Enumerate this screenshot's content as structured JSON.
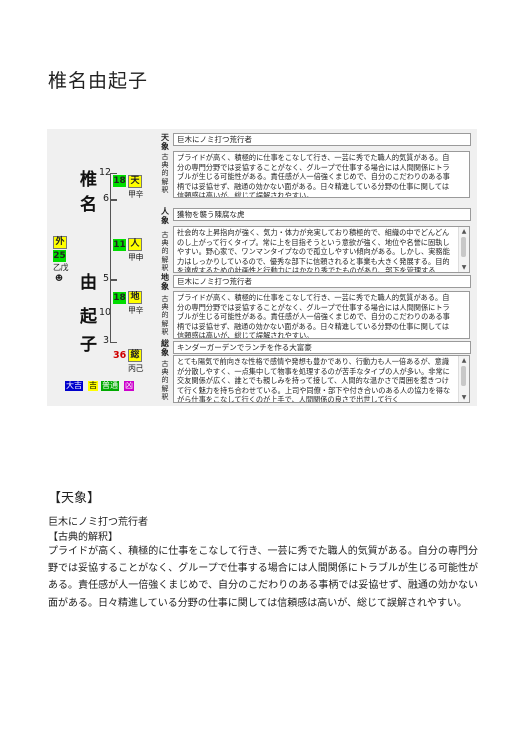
{
  "title": "椎名由起子",
  "name_chars": [
    {
      "char": "椎",
      "strokes": "12"
    },
    {
      "char": "名",
      "strokes": "6"
    },
    {
      "char": "由",
      "strokes": "5"
    },
    {
      "char": "起",
      "strokes": "10"
    },
    {
      "char": "子",
      "strokes": "3"
    }
  ],
  "kaku": {
    "ten": {
      "value": "18",
      "label": "天",
      "sub": "甲辛"
    },
    "jin": {
      "value": "11",
      "label": "人",
      "sub": "甲申"
    },
    "chi": {
      "value": "18",
      "label": "地",
      "sub": "甲辛"
    },
    "gai": {
      "value": "25",
      "label": "外",
      "sub": "乙戊"
    },
    "so": {
      "value": "36",
      "label": "総",
      "sub": "丙己"
    }
  },
  "luck_labels": [
    "大吉",
    "吉",
    "普通",
    "凶"
  ],
  "sections": [
    {
      "label": "天象",
      "sub": "古典的解釈",
      "title": "巨木にノミ打つ荒行者",
      "memo": "プライドが高く、積極的に仕事をこなして行き、一芸に秀でた職人的気質がある。自分の専門分野では妥協することがなく、グループで仕事する場合には人間関係にトラブルが生じる可能性がある。責任感が人一倍強くまじめで、自分のこだわりのある事柄では妥協せず、融通の効かない面がある。日々精進している分野の仕事に関しては信頼感は高いが、総じて誤解されやすい。"
    },
    {
      "label": "人象",
      "sub": "古典的解釈",
      "title": "獲物を襲う陳腐な虎",
      "memo": "社会的な上昇指向が強く、気力・体力が充実しており積極的で、組織の中でどんどんのし上がって行くタイプ。常に上を目指そうという意欲が強く、地位や名誉に固執しやすい。野心家で、ワンマンタイプなので孤立しやすい傾向がある。しかし、実務能力はしっかりしているので、優秀な部下に信頼されると事業も大きく発展する。目的を達成するための計画性と行動力にはかなり秀でたものがあり、部下を管理する"
    },
    {
      "label": "地象",
      "sub": "古典的解釈",
      "title": "巨木にノミ打つ荒行者",
      "memo": "プライドが高く、積極的に仕事をこなして行き、一芸に秀でた職人的気質がある。自分の専門分野では妥協することがなく、グループで仕事する場合には人間関係にトラブルが生じる可能性がある。責任感が人一倍強くまじめで、自分のこだわりのある事柄では妥協せず、融通の効かない面がある。日々精進している分野の仕事に関しては信頼感は高いが、総じて誤解されやすい。"
    },
    {
      "label": "総象",
      "sub": "古典的解釈",
      "title": "キンダーガーデンでランチを作る大富豪",
      "memo": "とても陽気で前向きな性格で感情や発想も豊かであり、行動力も人一倍あるが、意識が分散しやすく、一点集中して物事を処理するのが苦手なタイプの人が多い。非常に交友関係が広く、誰とでも親しみを持って接して、人間的な温かさで周囲を惹きつけて行く魅力を持ち合わせている。上司や同僚・部下や付き合いのある人の協力を得ながら仕事をこなして行くのが上手で、人間関係の良さで出世して行く"
    }
  ],
  "lower": {
    "heading": "【天象】",
    "lead": "巨木にノミ打つ荒行者",
    "sub": "【古典的解釈】",
    "body": "プライドが高く、積極的に仕事をこなして行き、一芸に秀でた職人的気質がある。自分の専門分野では妥協することがなく、グループで仕事する場合には人間関係にトラブルが生じる可能性がある。責任感が人一倍強くまじめで、自分のこだわりのある事柄では妥協せず、融通の効かない面がある。日々精進している分野の仕事に関しては信頼感は高いが、総じて誤解されやすい。"
  },
  "colors": {
    "green": "#00dd00",
    "yellow": "#ffff00",
    "red": "#d00000",
    "daikichi": "#0000cc",
    "futsu": "#00aa00",
    "kyo": "#cc00cc"
  }
}
